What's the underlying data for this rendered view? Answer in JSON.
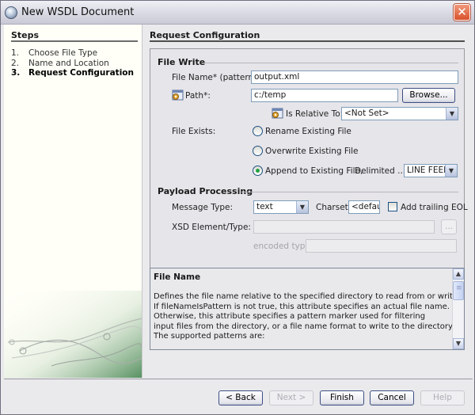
{
  "window": {
    "title": "New WSDL Document",
    "close_label": "✕"
  },
  "steps": {
    "title": "Steps",
    "items": [
      {
        "num": "1.",
        "label": "Choose File Type",
        "current": false
      },
      {
        "num": "2.",
        "label": "Name and Location",
        "current": false
      },
      {
        "num": "3.",
        "label": "Request Configuration",
        "current": true
      }
    ]
  },
  "main": {
    "title": "Request Configuration",
    "file_write": {
      "group_title": "File Write",
      "file_name_label": "File Name* (pattern):",
      "file_name_value": "output.xml",
      "path_label": "Path*:",
      "path_value": "c:/temp",
      "browse_label": "Browse...",
      "relative_label": "Is Relative To:",
      "relative_value": "<Not Set>",
      "file_exists_label": "File Exists:",
      "options": [
        {
          "label": "Rename Existing File",
          "checked": false
        },
        {
          "label": "Overwrite Existing File",
          "checked": false
        },
        {
          "label": "Append to Existing File,",
          "checked": true
        }
      ],
      "delimited_label": "Delimited ...",
      "delimiter_value": "LINE FEED"
    },
    "payload": {
      "group_title": "Payload Processing",
      "message_type_label": "Message Type:",
      "message_type_value": "text",
      "charset_label": "Charset:",
      "charset_value": "<default>",
      "trailing_eol_label": "Add trailing EOL",
      "trailing_eol_checked": false,
      "xsd_label": "XSD Element/Type:",
      "xsd_value": "",
      "xsd_browse_label": "...",
      "encoded_type_label": "encoded type:",
      "encoded_type_value": ""
    },
    "help": {
      "title": "File Name",
      "lines": [
        "Defines the file name relative to the specified directory to read from or write to.",
        "If fileNameIsPattern is not true, this attribute specifies an actual file name.",
        "Otherwise, this attribute specifies a pattern marker used for filtering",
        "input files from the directory, or a file name format to write to the directory;",
        "The supported patterns are:"
      ]
    }
  },
  "buttons": {
    "back": "< Back",
    "next": "Next >",
    "finish": "Finish",
    "cancel": "Cancel",
    "help": "Help"
  }
}
